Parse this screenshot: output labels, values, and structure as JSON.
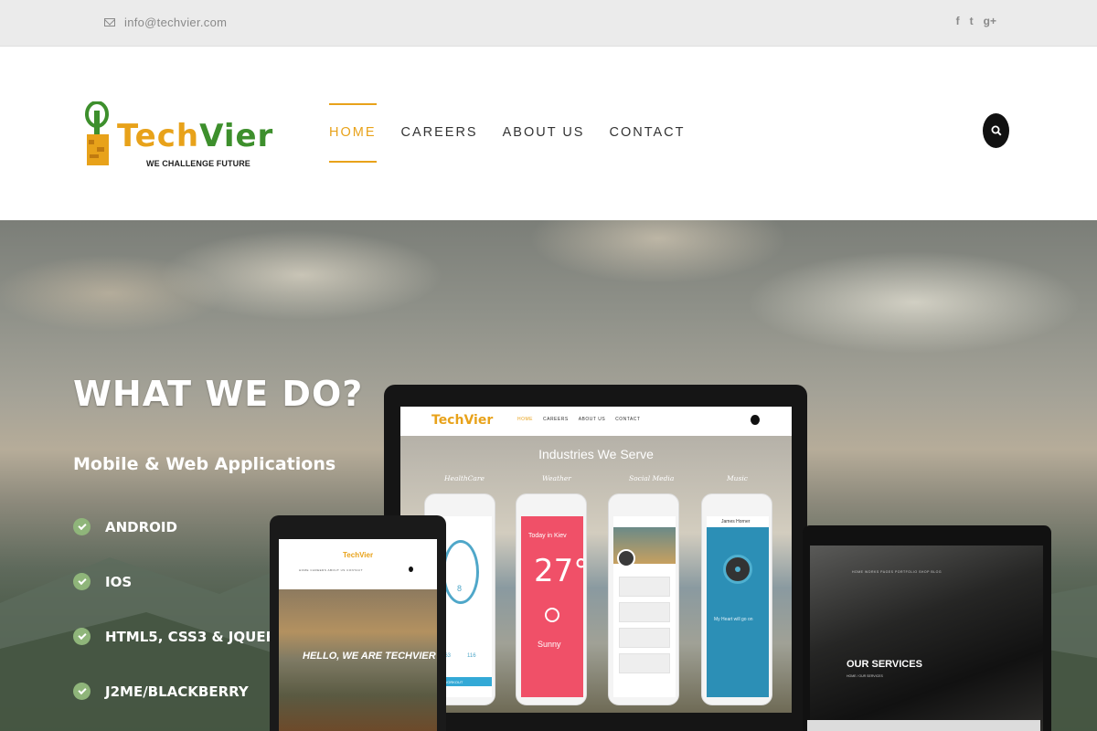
{
  "topbar": {
    "email": "info@techvier.com",
    "social": [
      "f",
      "t",
      "g+"
    ]
  },
  "header": {
    "logo_word_1": "Tech",
    "logo_word_2": "Vier",
    "logo_tagline": "WE CHALLENGE FUTURE",
    "nav": [
      {
        "label": "HOME",
        "active": true
      },
      {
        "label": "CAREERS",
        "active": false
      },
      {
        "label": "ABOUT US",
        "active": false
      },
      {
        "label": "CONTACT",
        "active": false
      }
    ],
    "search_icon": "search-icon"
  },
  "hero": {
    "title": "WHAT WE DO?",
    "subtitle": "Mobile & Web Applications",
    "features": [
      "ANDROID",
      "IOS",
      "HTML5, CSS3 & JQUERY",
      "J2ME/BLACKBERRY"
    ],
    "check_color": "#8fb57a"
  },
  "monitor": {
    "logo": "TechVier",
    "nav": [
      "HOME",
      "CAREERS",
      "ABOUT US",
      "CONTACT"
    ],
    "heading": "Industries We Serve",
    "categories": [
      "HealthCare",
      "Weather",
      "Social Media",
      "Music"
    ],
    "health": {
      "values": [
        "12.63",
        "116"
      ],
      "button": "STEP WORKOUT",
      "count": "8"
    },
    "weather": {
      "date": "Today in Kiev",
      "temp": "27°",
      "condition": "Sunny"
    },
    "music": {
      "artist": "James Horner",
      "caption": "My Heart will go on"
    }
  },
  "tablet": {
    "logo": "TechVier",
    "nav": "HOME  CAREERS  ABOUT US  CONTACT",
    "hero_text": "HELLO, WE ARE TECHVIER"
  },
  "laptop": {
    "nav": "HOME  WORKS  PAGES  PORTFOLIO  SHOP  BLOG",
    "heading": "OUR SERVICES",
    "breadcrumb": "HOME / OUR SERVICES"
  },
  "colors": {
    "accent": "#e8a21a",
    "brand_green": "#3d8f2c",
    "topbar_bg": "#ebebeb"
  }
}
